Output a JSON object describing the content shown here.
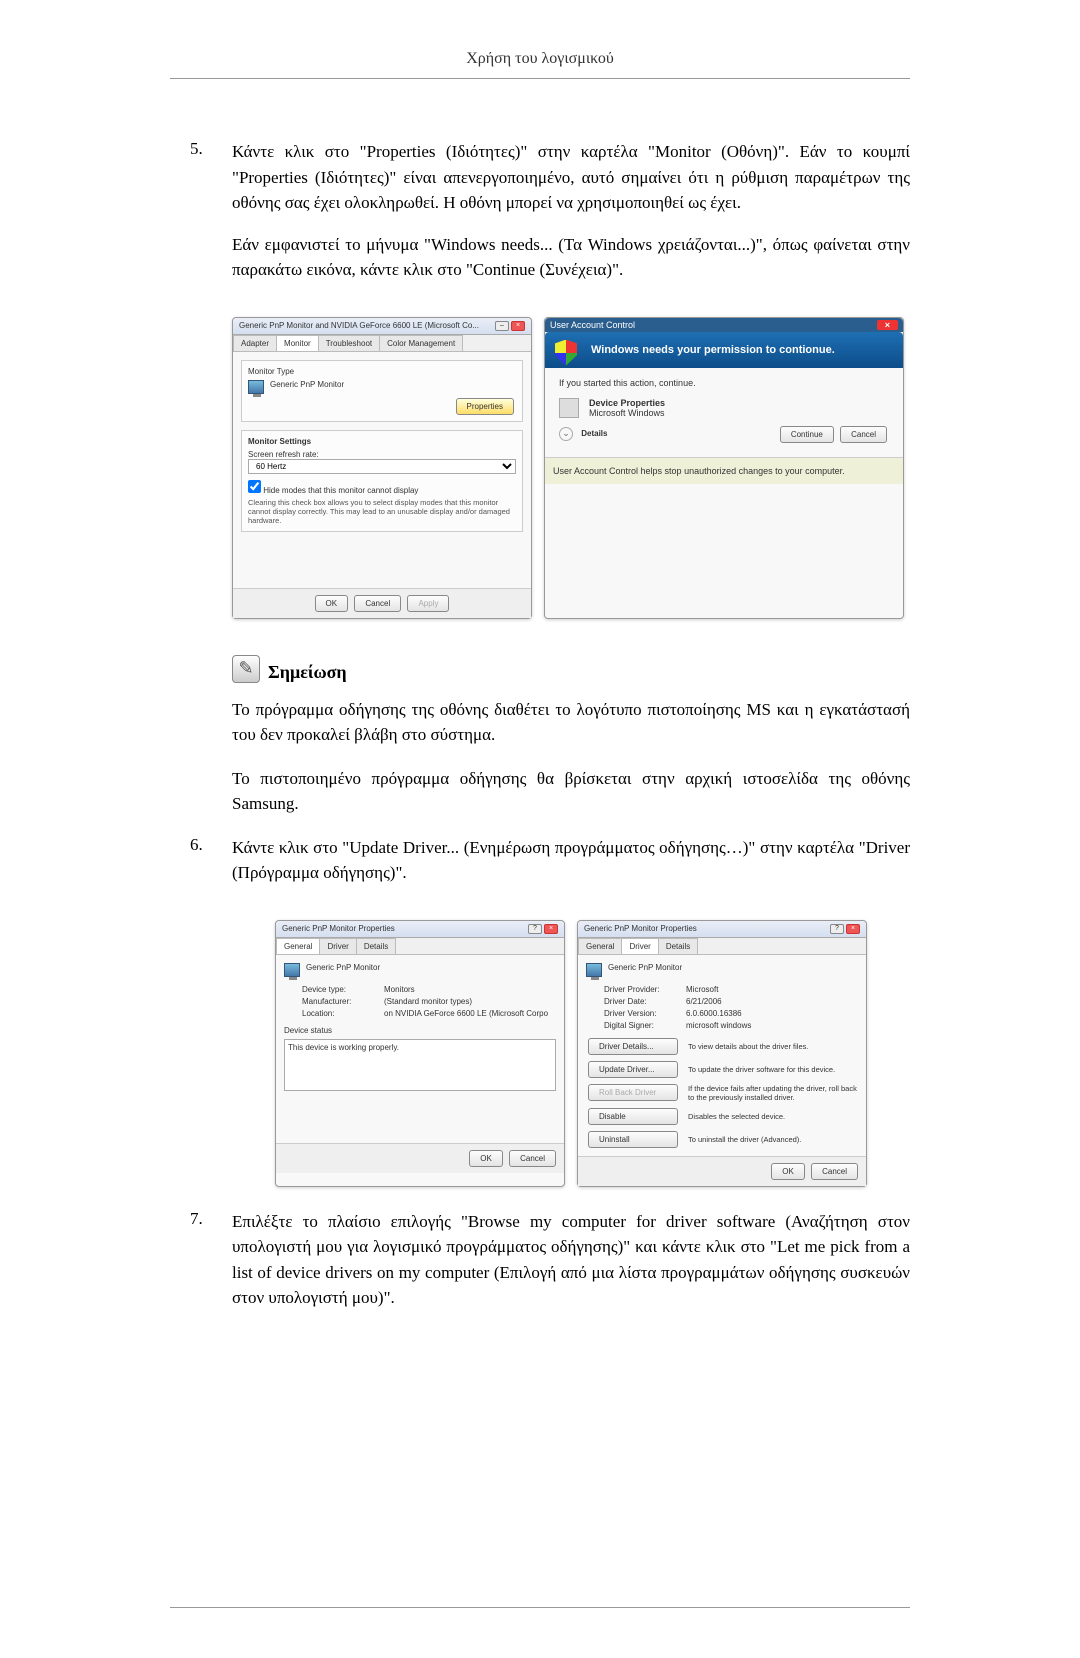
{
  "header": {
    "title": "Χρήση του λογισμικού"
  },
  "items": {
    "five": {
      "num": "5.",
      "p1": "Κάντε κλικ στο \"Properties (Ιδιότητες)\" στην καρτέλα \"Monitor (Οθόνη)\". Εάν το κουμπί \"Properties (Ιδιότητες)\" είναι απενεργοποιημένο, αυτό σημαίνει ότι η ρύθμιση παραμέτρων της οθόνης σας έχει ολοκληρωθεί. Η οθόνη μπορεί να χρησιμοποιηθεί ως έχει.",
      "p2": "Εάν εμφανιστεί το μήνυμα \"Windows needs... (Τα Windows χρειάζονται...)\", όπως φαίνεται στην παρακάτω εικόνα, κάντε κλικ στο \"Continue (Συνέχεια)\"."
    },
    "six": {
      "num": "6.",
      "p1": "Κάντε κλικ στο \"Update Driver... (Ενημέρωση προγράμματος οδήγησης…)\" στην καρτέλα \"Driver (Πρόγραμμα οδήγησης)\"."
    },
    "seven": {
      "num": "7.",
      "p1": "Επιλέξτε το πλαίσιο επιλογής \"Browse my computer for driver software (Αναζήτηση στον υπολογιστή μου για λογισμικό προγράμματος οδήγησης)\" και κάντε κλικ στο \"Let me pick from a list of device drivers on my computer (Επιλογή από μια λίστα προγραμμάτων οδήγησης συσκευών στον υπολογιστή μου)\"."
    }
  },
  "note": {
    "title": "Σημείωση",
    "p1": "Το πρόγραμμα οδήγησης της οθόνης διαθέτει το λογότυπο πιστοποίησης MS και η εγκατάστασή του δεν προκαλεί βλάβη στο σύστημα.",
    "p2": "Το πιστοποιημένο πρόγραμμα οδήγησης θα βρίσκεται στην αρχική ιστοσελίδα της οθόνης Samsung."
  },
  "shot1": {
    "title": "Generic PnP Monitor and NVIDIA GeForce 6600 LE (Microsoft Co...",
    "tabs": {
      "adapter": "Adapter",
      "monitor": "Monitor",
      "troubleshoot": "Troubleshoot",
      "color": "Color Management"
    },
    "monitor_type": "Monitor Type",
    "device": "Generic PnP Monitor",
    "props_btn": "Properties",
    "settings": "Monitor Settings",
    "refresh_label": "Screen refresh rate:",
    "refresh_value": "60 Hertz",
    "hide_check": "Hide modes that this monitor cannot display",
    "hide_desc": "Clearing this check box allows you to select display modes that this monitor cannot display correctly. This may lead to an unusable display and/or damaged hardware.",
    "ok": "OK",
    "cancel": "Cancel",
    "apply": "Apply"
  },
  "uac": {
    "title": "User Account Control",
    "header": "Windows needs your permission to contionue.",
    "subtitle": "If you started this action, continue.",
    "item_title": "Device Properties",
    "item_sub": "Microsoft Windows",
    "details": "Details",
    "continue": "Continue",
    "cancel": "Cancel",
    "footer": "User Account Control helps stop unauthorized changes to your computer."
  },
  "shot2a": {
    "title": "Generic PnP Monitor Properties",
    "tabs": {
      "general": "General",
      "driver": "Driver",
      "details": "Details"
    },
    "device": "Generic PnP Monitor",
    "rows": {
      "type_k": "Device type:",
      "type_v": "Monitors",
      "man_k": "Manufacturer:",
      "man_v": "(Standard monitor types)",
      "loc_k": "Location:",
      "loc_v": "on NVIDIA GeForce 6600 LE (Microsoft Corpo"
    },
    "status_label": "Device status",
    "status_text": "This device is working properly.",
    "ok": "OK",
    "cancel": "Cancel"
  },
  "shot2b": {
    "title": "Generic PnP Monitor Properties",
    "tabs": {
      "general": "General",
      "driver": "Driver",
      "details": "Details"
    },
    "device": "Generic PnP Monitor",
    "rows": {
      "prov_k": "Driver Provider:",
      "prov_v": "Microsoft",
      "date_k": "Driver Date:",
      "date_v": "6/21/2006",
      "ver_k": "Driver Version:",
      "ver_v": "6.0.6000.16386",
      "sig_k": "Digital Signer:",
      "sig_v": "microsoft windows"
    },
    "btns": {
      "details": "Driver Details...",
      "details_d": "To view details about the driver files.",
      "update": "Update Driver...",
      "update_d": "To update the driver software for this device.",
      "roll": "Roll Back Driver",
      "roll_d": "If the device fails after updating the driver, roll back to the previously installed driver.",
      "disable": "Disable",
      "disable_d": "Disables the selected device.",
      "uninst": "Uninstall",
      "uninst_d": "To uninstall the driver (Advanced)."
    },
    "ok": "OK",
    "cancel": "Cancel"
  }
}
